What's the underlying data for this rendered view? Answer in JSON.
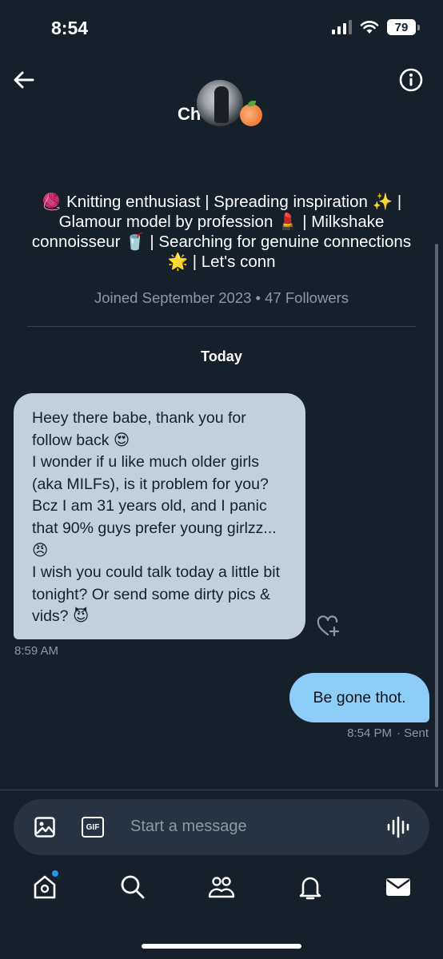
{
  "status_bar": {
    "time": "8:54",
    "battery": "79"
  },
  "header": {
    "back_icon": "arrow-left-icon",
    "info_icon": "info-circle-icon",
    "name": "Ch",
    "avatar_icon": "profile-photo",
    "name_emoji_icon": "peach-emoji"
  },
  "profile": {
    "bio": "🧶 Knitting enthusiast | Spreading inspiration ✨ | Glamour model by profession 💄 | Milkshake connoisseur 🥤 | Searching for genuine connections 🌟 | Let's conn",
    "joined": "Joined September 2023 • 47 Followers"
  },
  "conversation": {
    "day_label": "Today",
    "messages": [
      {
        "direction": "incoming",
        "lines": [
          "Heey there babe, thank you for follow back 😍",
          "I wonder if u like much older girls (aka MILFs), is it problem for you? Bcz I am 31 years old, and I panic that 90% guys prefer young girlzz... 😠",
          "I wish you could talk today a little bit tonight? Or send some dirty pics & vids? 😈"
        ],
        "time": "8:59 AM"
      },
      {
        "direction": "outgoing",
        "text": "Be gone thot.",
        "time": "8:54 PM",
        "status": "· Sent"
      }
    ]
  },
  "composer": {
    "placeholder": "Start a message",
    "gif_label": "GIF",
    "image_icon": "image-icon",
    "voice_icon": "voice-waveform-icon"
  },
  "bottom_nav": {
    "items": [
      "home-icon",
      "search-icon",
      "communities-icon",
      "notifications-icon",
      "messages-icon"
    ]
  },
  "colors": {
    "background": "#15202b",
    "incoming_bubble": "#c2d0dc",
    "outgoing_bubble": "#8ecdf8",
    "muted_text": "#8b98a5",
    "accent": "#1d9bf0"
  }
}
